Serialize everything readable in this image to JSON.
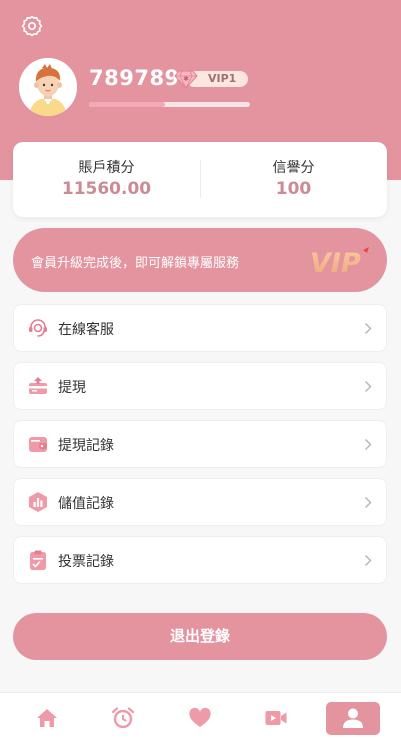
{
  "profile": {
    "username": "789789",
    "vip_level": "VIP1",
    "progress_percent": 47
  },
  "stats": [
    {
      "label": "賬戶積分",
      "value": "11560.00"
    },
    {
      "label": "信譽分",
      "value": "100"
    }
  ],
  "vip_banner": {
    "text": "會員升級完成後，即可解鎖專屬服務",
    "logo_text": "VIP"
  },
  "menu": [
    {
      "label": "在線客服",
      "icon": "headset-icon"
    },
    {
      "label": "提現",
      "icon": "withdraw-icon"
    },
    {
      "label": "提現記錄",
      "icon": "wallet-icon"
    },
    {
      "label": "儲值記錄",
      "icon": "chart-icon"
    },
    {
      "label": "投票記錄",
      "icon": "clipboard-icon"
    }
  ],
  "logout_label": "退出登錄",
  "tabs": [
    {
      "name": "home",
      "icon": "home-icon",
      "active": false
    },
    {
      "name": "alarm",
      "icon": "alarm-clock-icon",
      "active": false
    },
    {
      "name": "favorites",
      "icon": "heart-icon",
      "active": false
    },
    {
      "name": "video",
      "icon": "video-icon",
      "active": false
    },
    {
      "name": "profile",
      "icon": "user-icon",
      "active": true
    }
  ],
  "colors": {
    "primary": "#e3949f",
    "value_text": "#cb8b95",
    "background": "#f7f7f7"
  }
}
